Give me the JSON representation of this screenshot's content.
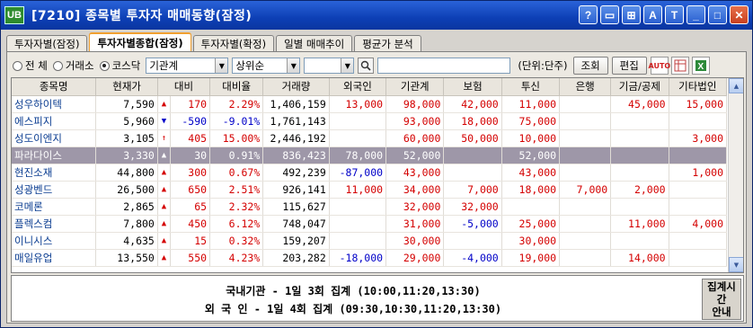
{
  "window": {
    "app_icon": "UB",
    "title": "[7210] 종목별 투자자 매매동향(잠정)",
    "controls": [
      "?",
      "▭",
      "⊞",
      "A",
      "T",
      "_",
      "□",
      "✕"
    ]
  },
  "tabs": [
    "투자자별(잠정)",
    "투자자별종합(잠정)",
    "투자자별(확정)",
    "일별 매매추이",
    "평균가 분석"
  ],
  "toolbar": {
    "market_options": [
      "전 체",
      "거래소",
      "코스닥"
    ],
    "selected_market": "코스닥",
    "investor_select": "기관계",
    "rank_select": "상위순",
    "blank_select": "",
    "unit_label": "(단위:단주)",
    "query_button": "조회",
    "edit_button": "편집",
    "auto_label": "AUTO"
  },
  "columns": [
    "종목명",
    "현재가",
    "대비",
    "대비율",
    "거래량",
    "외국인",
    "기관계",
    "보험",
    "투신",
    "은행",
    "기금/공제",
    "기타법인"
  ],
  "rows": [
    {
      "name": "성우하이텍",
      "price": "7,590",
      "dir": "▲",
      "change": "170",
      "rate": "2.29%",
      "volume": "1,406,159",
      "foreign": "13,000",
      "inst": "98,000",
      "insur": "42,000",
      "trust": "11,000",
      "bank": "",
      "fund": "45,000",
      "etc": "15,000",
      "sign": "up"
    },
    {
      "name": "에스피지",
      "price": "5,960",
      "dir": "▼",
      "change": "-590",
      "rate": "-9.01%",
      "volume": "1,761,143",
      "foreign": "",
      "inst": "93,000",
      "insur": "18,000",
      "trust": "75,000",
      "bank": "",
      "fund": "",
      "etc": "",
      "sign": "dn"
    },
    {
      "name": "성도이엔지",
      "price": "3,105",
      "dir": "↑",
      "change": "405",
      "rate": "15.00%",
      "volume": "2,446,192",
      "foreign": "",
      "inst": "60,000",
      "insur": "50,000",
      "trust": "10,000",
      "bank": "",
      "fund": "",
      "etc": "3,000",
      "sign": "up"
    },
    {
      "name": "파라다이스",
      "price": "3,330",
      "dir": "▲",
      "change": "30",
      "rate": "0.91%",
      "volume": "836,423",
      "foreign": "78,000",
      "inst": "52,000",
      "insur": "",
      "trust": "52,000",
      "bank": "",
      "fund": "",
      "etc": "",
      "sign": "up",
      "selected": true
    },
    {
      "name": "현진소재",
      "price": "44,800",
      "dir": "▲",
      "change": "300",
      "rate": "0.67%",
      "volume": "492,239",
      "foreign": "-87,000",
      "inst": "43,000",
      "insur": "",
      "trust": "43,000",
      "bank": "",
      "fund": "",
      "etc": "1,000",
      "sign": "up"
    },
    {
      "name": "성광벤드",
      "price": "26,500",
      "dir": "▲",
      "change": "650",
      "rate": "2.51%",
      "volume": "926,141",
      "foreign": "11,000",
      "inst": "34,000",
      "insur": "7,000",
      "trust": "18,000",
      "bank": "7,000",
      "fund": "2,000",
      "etc": "",
      "sign": "up"
    },
    {
      "name": "코메론",
      "price": "2,865",
      "dir": "▲",
      "change": "65",
      "rate": "2.32%",
      "volume": "115,627",
      "foreign": "",
      "inst": "32,000",
      "insur": "32,000",
      "trust": "",
      "bank": "",
      "fund": "",
      "etc": "",
      "sign": "up"
    },
    {
      "name": "플렉스컴",
      "price": "7,800",
      "dir": "▲",
      "change": "450",
      "rate": "6.12%",
      "volume": "748,047",
      "foreign": "",
      "inst": "31,000",
      "insur": "-5,000",
      "trust": "25,000",
      "bank": "",
      "fund": "11,000",
      "etc": "4,000",
      "sign": "up"
    },
    {
      "name": "이니시스",
      "price": "4,635",
      "dir": "▲",
      "change": "15",
      "rate": "0.32%",
      "volume": "159,207",
      "foreign": "",
      "inst": "30,000",
      "insur": "",
      "trust": "30,000",
      "bank": "",
      "fund": "",
      "etc": "",
      "sign": "up"
    },
    {
      "name": "매일유업",
      "price": "13,550",
      "dir": "▲",
      "change": "550",
      "rate": "4.23%",
      "volume": "203,282",
      "foreign": "-18,000",
      "inst": "29,000",
      "insur": "-4,000",
      "trust": "19,000",
      "bank": "",
      "fund": "14,000",
      "etc": "",
      "sign": "up"
    }
  ],
  "footer": {
    "line1": "국내기관 - 1일 3회 집계 (10:00,11:20,13:30)",
    "line2": "외 국 인 - 1일 4회 집계 (09:30,10:30,11:20,13:30)",
    "button": "집계시간\n안내"
  },
  "colors": {
    "up": "#d40000",
    "down": "#0000c8",
    "selected_row": "#9e97a8",
    "titlebar": "#0d3fb5"
  }
}
